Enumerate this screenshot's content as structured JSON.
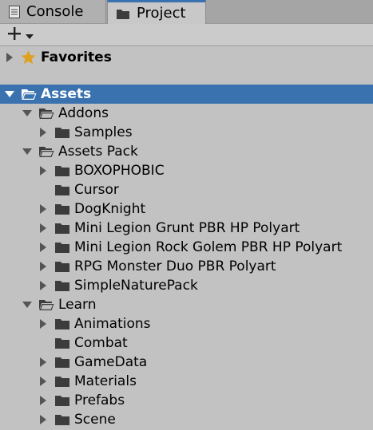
{
  "tabs": [
    {
      "label": "Console",
      "icon": "console-icon",
      "active": false
    },
    {
      "label": "Project",
      "icon": "folder-icon",
      "active": true
    }
  ],
  "toolbar": {
    "create_icon": "plus-icon",
    "dropdown_icon": "chevron-down-icon"
  },
  "favorites": {
    "label": "Favorites",
    "icon": "star-icon"
  },
  "colors": {
    "selected": "#3a72b0",
    "star": "#e0a020",
    "panel": "#c2c2c2"
  },
  "tree": [
    {
      "label": "Assets",
      "depth": 0,
      "state": "expanded",
      "selected": true,
      "open": true
    },
    {
      "label": "Addons",
      "depth": 1,
      "state": "expanded",
      "open": true
    },
    {
      "label": "Samples",
      "depth": 2,
      "state": "collapsed"
    },
    {
      "label": "Assets Pack",
      "depth": 1,
      "state": "expanded",
      "open": true
    },
    {
      "label": "BOXOPHOBIC",
      "depth": 2,
      "state": "collapsed"
    },
    {
      "label": "Cursor",
      "depth": 2,
      "state": "leaf"
    },
    {
      "label": "DogKnight",
      "depth": 2,
      "state": "collapsed"
    },
    {
      "label": "Mini Legion Grunt PBR HP Polyart",
      "depth": 2,
      "state": "collapsed"
    },
    {
      "label": "Mini Legion Rock Golem PBR HP Polyart",
      "depth": 2,
      "state": "collapsed"
    },
    {
      "label": "RPG Monster Duo PBR Polyart",
      "depth": 2,
      "state": "collapsed"
    },
    {
      "label": "SimpleNaturePack",
      "depth": 2,
      "state": "collapsed"
    },
    {
      "label": "Learn",
      "depth": 1,
      "state": "expanded",
      "open": true
    },
    {
      "label": "Animations",
      "depth": 2,
      "state": "collapsed"
    },
    {
      "label": "Combat",
      "depth": 2,
      "state": "leaf"
    },
    {
      "label": "GameData",
      "depth": 2,
      "state": "collapsed"
    },
    {
      "label": "Materials",
      "depth": 2,
      "state": "collapsed"
    },
    {
      "label": "Prefabs",
      "depth": 2,
      "state": "collapsed"
    },
    {
      "label": "Scene",
      "depth": 2,
      "state": "collapsed"
    }
  ]
}
